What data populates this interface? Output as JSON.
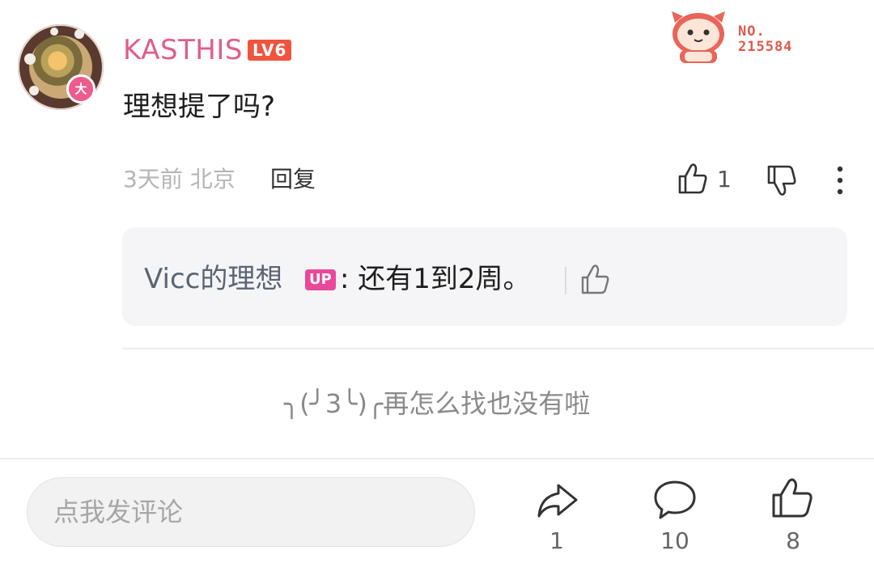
{
  "comment": {
    "username": "KASTHIS",
    "level_badge": "LV6",
    "vip_badge": "大",
    "fan_badge": {
      "line1": "NO.",
      "line2": "215584"
    },
    "text": "理想提了吗?",
    "meta": "3天前 北京",
    "reply_label": "回复",
    "like_count": "1"
  },
  "reply": {
    "name": "Vicc的理想",
    "up_badge": "UP",
    "text": ": 还有1到2周。"
  },
  "end_message": "╮(╯3╰)╭再怎么找也没有啦",
  "bottom_bar": {
    "input_placeholder": "点我发评论",
    "share_count": "1",
    "comment_count": "10",
    "like_count": "8"
  },
  "colors": {
    "username": "#e05d8c",
    "level_badge": "#f0543e",
    "up_badge": "#e9489b"
  }
}
